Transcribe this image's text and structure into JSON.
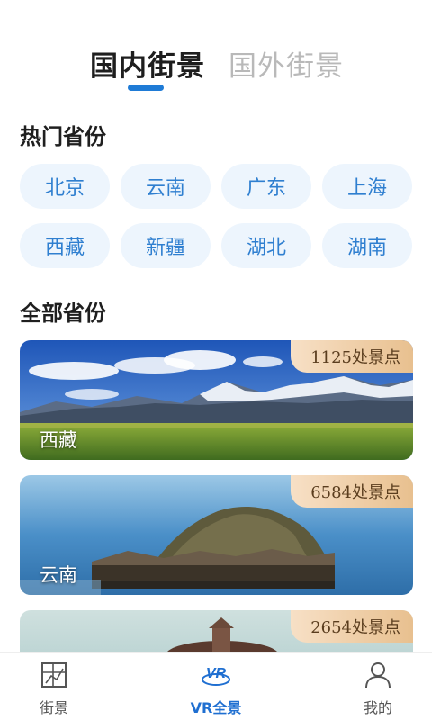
{
  "tabs": {
    "domestic": "国内街景",
    "overseas": "国外街景"
  },
  "hot_title": "热门省份",
  "hot_provinces": [
    "北京",
    "云南",
    "广东",
    "上海",
    "西藏",
    "新疆",
    "湖北",
    "湖南"
  ],
  "all_title": "全部省份",
  "cards": [
    {
      "name": "西藏",
      "count": "1125处景点"
    },
    {
      "name": "云南",
      "count": "6584处景点"
    },
    {
      "name": "",
      "count": "2654处景点"
    }
  ],
  "nav": {
    "street": "街景",
    "vr": "VR全景",
    "mine": "我的"
  },
  "colors": {
    "accent": "#1f7bd6",
    "chip_bg": "#edf5fd",
    "chip_text": "#2f7fd0",
    "badge": "#e8c08f"
  },
  "icons": {
    "street": "map-grid-icon",
    "vr": "vr-panorama-icon",
    "mine": "user-icon"
  }
}
